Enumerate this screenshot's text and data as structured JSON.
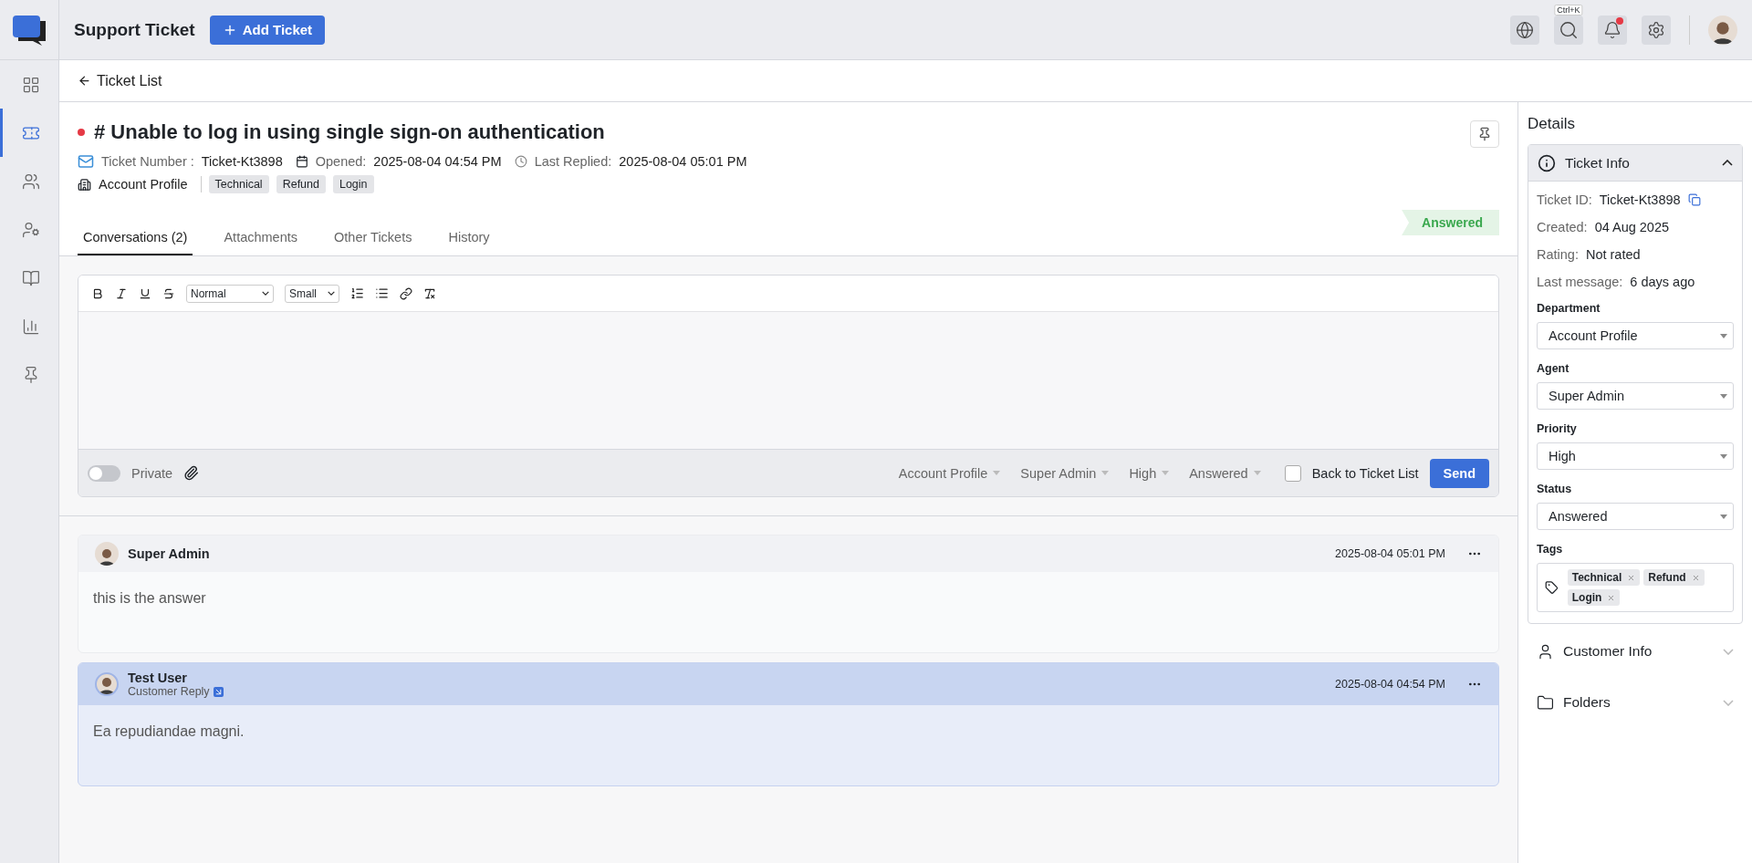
{
  "app": {
    "title": "Support Ticket",
    "add_button": "Add Ticket",
    "search_shortcut": "Ctrl+K",
    "notifications_unread": true
  },
  "sidebar": {
    "items": [
      {
        "kind": "dashboard",
        "selected": false
      },
      {
        "kind": "tickets",
        "selected": true
      },
      {
        "kind": "customers",
        "selected": false
      },
      {
        "kind": "agents",
        "selected": false
      },
      {
        "kind": "knowledge",
        "selected": false
      },
      {
        "kind": "reports",
        "selected": false
      },
      {
        "kind": "pins",
        "selected": false
      }
    ]
  },
  "breadcrumb": {
    "back": "Ticket List"
  },
  "ticket": {
    "title": "# Unable to log in using single sign-on authentication",
    "number_label": "Ticket Number :",
    "number": "Ticket-Kt3898",
    "opened_label": "Opened:",
    "opened": "2025-08-04 04:54 PM",
    "replied_label": "Last Replied:",
    "replied": "2025-08-04 05:01 PM",
    "department": "Account Profile",
    "tags": [
      "Technical",
      "Refund",
      "Login"
    ],
    "status": "Answered"
  },
  "tabs": [
    {
      "label": "Conversations (2)",
      "selected": true
    },
    {
      "label": "Attachments",
      "selected": false
    },
    {
      "label": "Other Tickets",
      "selected": false
    },
    {
      "label": "History",
      "selected": false
    }
  ],
  "editor": {
    "format": "Normal",
    "size": "Small",
    "private": {
      "label": "Private",
      "on": false
    },
    "selects": [
      "Account Profile",
      "Super Admin",
      "High",
      "Answered"
    ],
    "back_to_list": {
      "label": "Back to Ticket List",
      "checked": false
    },
    "send": "Send"
  },
  "messages": [
    {
      "kind": "agent",
      "author": "Super Admin",
      "time": "2025-08-04 05:01 PM",
      "body": "this is the answer"
    },
    {
      "kind": "customer",
      "author": "Test User",
      "subtitle": "Customer Reply",
      "time": "2025-08-04 04:54 PM",
      "body": "Ea repudiandae magni."
    }
  ],
  "details": {
    "title": "Details",
    "ticket_info": {
      "title": "Ticket Info",
      "expanded": true,
      "fields": [
        {
          "label": "Ticket ID:",
          "value": "Ticket-Kt3898",
          "copy": true
        },
        {
          "label": "Created:",
          "value": "04 Aug 2025",
          "copy": false
        },
        {
          "label": "Rating:",
          "value": "Not rated",
          "copy": false
        },
        {
          "label": "Last message:",
          "value": "6 days ago",
          "copy": false
        }
      ],
      "selects": [
        {
          "label": "Department",
          "value": "Account Profile"
        },
        {
          "label": "Agent",
          "value": "Super Admin"
        },
        {
          "label": "Priority",
          "value": "High"
        },
        {
          "label": "Status",
          "value": "Answered"
        }
      ],
      "tags_label": "Tags",
      "tags": [
        "Technical",
        "Refund",
        "Login"
      ]
    },
    "sections": [
      {
        "kind": "customer",
        "title": "Customer Info",
        "expanded": false
      },
      {
        "kind": "folder",
        "title": "Folders",
        "expanded": false
      }
    ]
  }
}
